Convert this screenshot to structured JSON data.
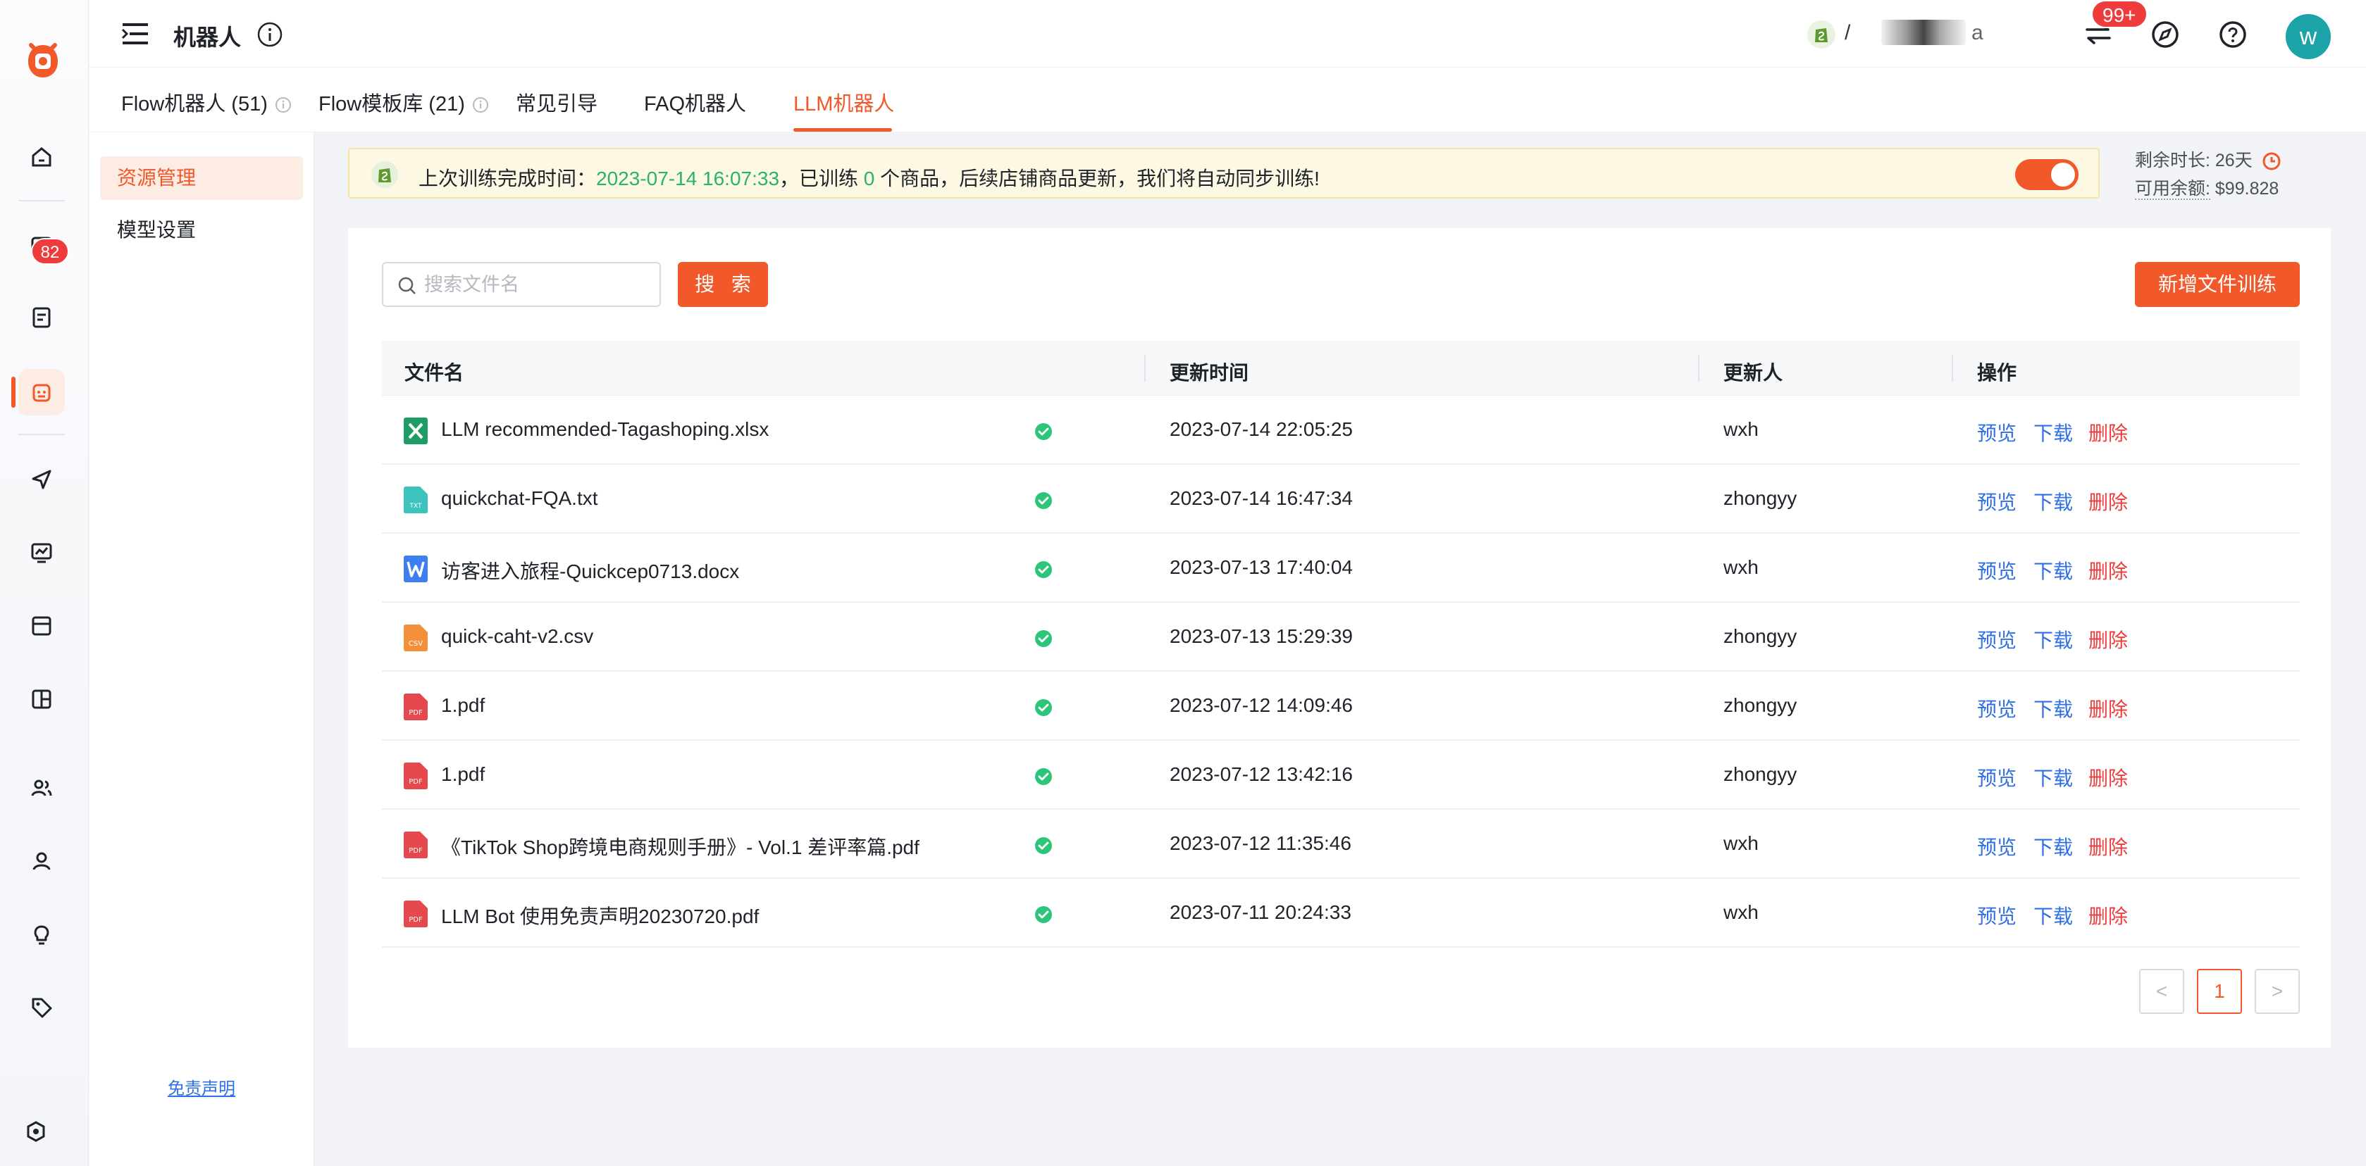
{
  "header": {
    "title": "机器人",
    "store_slash": "/",
    "store_tail": "a",
    "notification_count": "99+",
    "avatar_letter": "w"
  },
  "rail": {
    "messages_badge": "82"
  },
  "tabs": [
    {
      "label": "Flow机器人 (51)"
    },
    {
      "label": "Flow模板库 (21)"
    },
    {
      "label": "常见引导"
    },
    {
      "label": "FAQ机器人"
    },
    {
      "label": "LLM机器人"
    }
  ],
  "subnav": {
    "items": [
      {
        "label": "资源管理"
      },
      {
        "label": "模型设置"
      }
    ],
    "disclaimer": "免责声明"
  },
  "notice": {
    "prefix": "上次训练完成时间：",
    "time": "2023-07-14 16:07:33",
    "mid": "，已训练 ",
    "count": "0",
    "suffix": " 个商品，后续店铺商品更新，我们将自动同步训练!",
    "auto_sync_enabled": true
  },
  "balance": {
    "remaining_label": "剩余时长:",
    "remaining_value": "26天",
    "available_label": "可用余额:",
    "available_value": "$99.828"
  },
  "toolbar": {
    "search_placeholder": "搜索文件名",
    "search_button": "搜 索",
    "add_button": "新增文件训练"
  },
  "table": {
    "headers": [
      "文件名",
      "更新时间",
      "更新人",
      "操作"
    ],
    "actions": {
      "preview": "预览",
      "download": "下载",
      "delete": "删除"
    },
    "rows": [
      {
        "name": "LLM recommended-Tagashoping.xlsx",
        "type": "xlsx",
        "time": "2023-07-14 22:05:25",
        "user": "wxh"
      },
      {
        "name": "quickchat-FQA.txt",
        "type": "txt",
        "time": "2023-07-14 16:47:34",
        "user": "zhongyy"
      },
      {
        "name": "访客进入旅程-Quickcep0713.docx",
        "type": "docx",
        "time": "2023-07-13 17:40:04",
        "user": "wxh"
      },
      {
        "name": "quick-caht-v2.csv",
        "type": "csv",
        "time": "2023-07-13 15:29:39",
        "user": "zhongyy"
      },
      {
        "name": "1.pdf",
        "type": "pdf",
        "time": "2023-07-12 14:09:46",
        "user": "zhongyy"
      },
      {
        "name": "1.pdf",
        "type": "pdf",
        "time": "2023-07-12 13:42:16",
        "user": "zhongyy"
      },
      {
        "name": "《TikTok Shop跨境电商规则手册》- Vol.1 差评率篇.pdf",
        "type": "pdf",
        "time": "2023-07-12 11:35:46",
        "user": "wxh"
      },
      {
        "name": "LLM Bot 使用免责声明20230720.pdf",
        "type": "pdf",
        "time": "2023-07-11 20:24:33",
        "user": "wxh"
      }
    ]
  },
  "pagination": {
    "prev": "<",
    "current": "1",
    "next": ">"
  },
  "colors": {
    "accent": "#f1582a",
    "link": "#2f6fe4",
    "danger": "#ee3b3b",
    "success": "#28b36b"
  }
}
